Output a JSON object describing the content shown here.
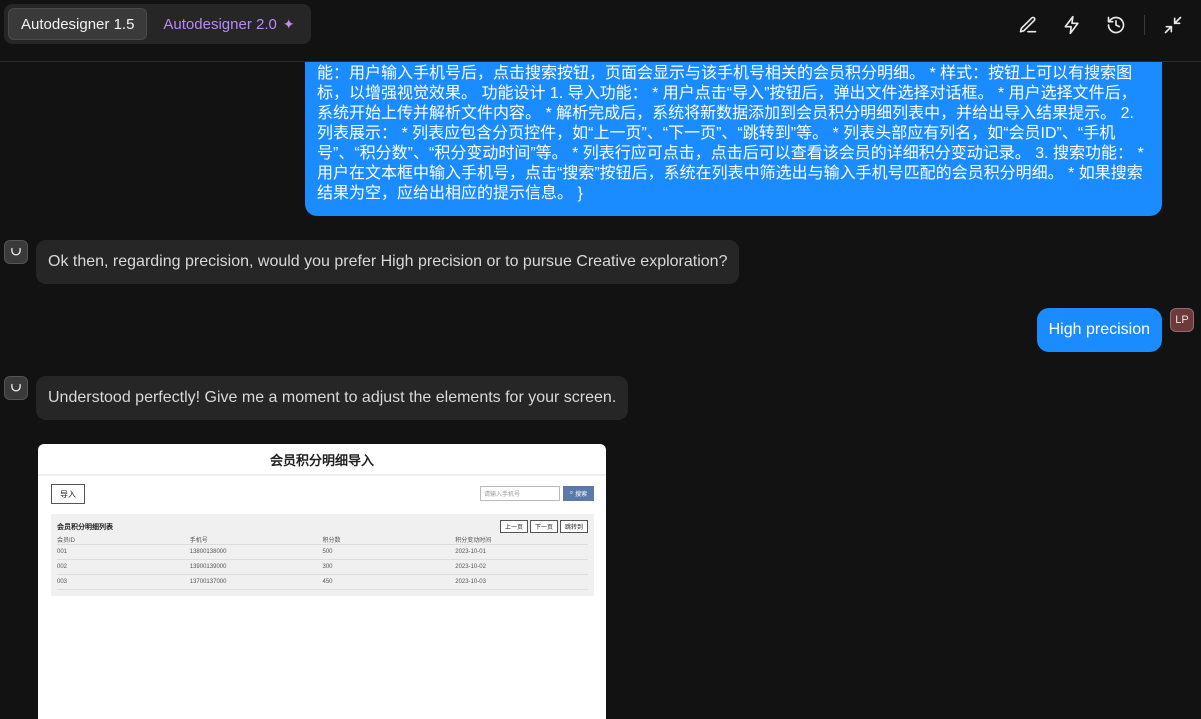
{
  "header": {
    "tabs": [
      {
        "label": "Autodesigner 1.5"
      },
      {
        "label": "Autodesigner 2.0"
      }
    ],
    "tools": [
      "edit-icon",
      "bolt-icon",
      "history-icon",
      "collapse-icon"
    ]
  },
  "chat": {
    "user_long_message": "能：用户输入手机号后，点击搜索按钮，页面会显示与该手机号相关的会员积分明细。 * 样式：按钮上可以有搜索图标，以增强视觉效果。 功能设计 1. 导入功能： * 用户点击“导入”按钮后，弹出文件选择对话框。 * 用户选择文件后，系统开始上传并解析文件内容。 * 解析完成后，系统将新数据添加到会员积分明细列表中，并给出导入结果提示。 2. 列表展示： * 列表应包含分页控件，如“上一页”、“下一页”、“跳转到”等。 * 列表头部应有列名，如“会员ID”、“手机号”、“积分数”、“积分变动时间”等。 * 列表行应可点击，点击后可以查看该会员的详细积分变动记录。 3. 搜索功能： * 用户在文本框中输入手机号，点击“搜索”按钮后，系统在列表中筛选出与输入手机号匹配的会员积分明细。 * 如果搜索结果为空，应给出相应的提示信息。 }",
    "ai_message_1": "Ok then, regarding precision, would you prefer High precision or to pursue Creative exploration?",
    "user_reply": "High precision",
    "user_initials": "LP",
    "ai_message_2": "Understood perfectly! Give me a moment to adjust the elements for your screen."
  },
  "preview": {
    "title": "会员积分明细导入",
    "import_label": "导入",
    "search_placeholder": "请输入手机号",
    "search_label": "搜索",
    "list_title": "会员积分明细列表",
    "pager": [
      "上一页",
      "下一页",
      "跳转到"
    ],
    "columns": [
      "会员ID",
      "手机号",
      "积分数",
      "积分变动时间"
    ],
    "rows": [
      [
        "001",
        "13800138000",
        "500",
        "2023-10-01"
      ],
      [
        "002",
        "13900139000",
        "300",
        "2023-10-02"
      ],
      [
        "003",
        "13700137000",
        "450",
        "2023-10-03"
      ]
    ]
  }
}
